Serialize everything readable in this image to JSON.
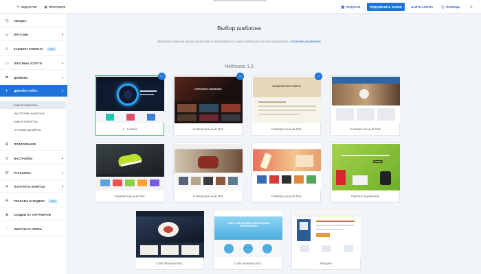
{
  "topbar": {
    "editor": "Редактор",
    "preview": "Просмотр",
    "gift": "Подарок",
    "connect_tariff": "Подключить тариф",
    "find_agent": "Найти агента",
    "help": "Помощь"
  },
  "sidebar": {
    "items": [
      {
        "label": "Сводка",
        "icon": "clock-icon"
      },
      {
        "label": "Магазин",
        "icon": "cart-icon",
        "caret": "▼"
      },
      {
        "label": "Кабинет клиента",
        "icon": "users-icon",
        "badge": "NEW"
      },
      {
        "label": "Платные услуги",
        "icon": "card-icon",
        "caret": "▼"
      },
      {
        "label": "Домены",
        "icon": "flag-icon",
        "caret": "▼"
      },
      {
        "label": "Дизайн сайта",
        "icon": "brush-icon",
        "caret": "▼"
      },
      {
        "label": "Приложения",
        "icon": "apps-icon"
      },
      {
        "label": "Настройки",
        "icon": "sliders-icon",
        "caret": "▼"
      },
      {
        "label": "Рассылка",
        "icon": "mail-icon",
        "caret": "▼"
      },
      {
        "label": "Получить бонусы",
        "icon": "gift-icon",
        "caret": "▼"
      },
      {
        "label": "Реклама в Яндекс",
        "icon": "yandex-icon",
        "badge": "NEW"
      },
      {
        "label": "Скидки от партнеров",
        "icon": "tag-icon"
      },
      {
        "label": "Обратная связь",
        "icon": "chat-icon"
      }
    ],
    "subitems": [
      "Выбор шаблона",
      "Настройки шаблона",
      "Выбор шрифтов",
      "Готовые дизайны"
    ]
  },
  "main": {
    "title": "Выбор шаблона",
    "subtitle": "Выберите один из наших шаблонов и заполните его самостоятельно или воспользуйтесь",
    "subtitle_link": "готовыми дизайнами",
    "group_title": "Nethouse 1.0"
  },
  "templates": [
    {
      "label": "Новый",
      "selected": true,
      "adaptive": true
    },
    {
      "label": "Универсальный №1",
      "adaptive": true
    },
    {
      "label": "Универсальный №2",
      "adaptive": true
    },
    {
      "label": "Универсальный №3"
    },
    {
      "label": "Универсальный №4"
    },
    {
      "label": "Универсальный №5"
    },
    {
      "label": "Универсальный №6"
    },
    {
      "label": "Презентационный"
    },
    {
      "label": "Сайт-визитка №1"
    },
    {
      "label": "Сайт-визитка №2"
    },
    {
      "label": "Лендинг"
    }
  ],
  "thumbs": {
    "t2_heading": "ПОРТФОЛИО ХУДОЖНИКА",
    "t3_heading": "КАНЦЕЛЯРСКИЕ ТОВАРЫ",
    "t10_heading": "А ВОТ ФОН БАННЕРА МОЖЕТ БЫТЬ ПРОЗРАЧНЫМ!"
  },
  "colors": {
    "accent": "#1e74d8",
    "selected_border": "#3bb36a",
    "badge_bg": "#d6ecf9"
  }
}
